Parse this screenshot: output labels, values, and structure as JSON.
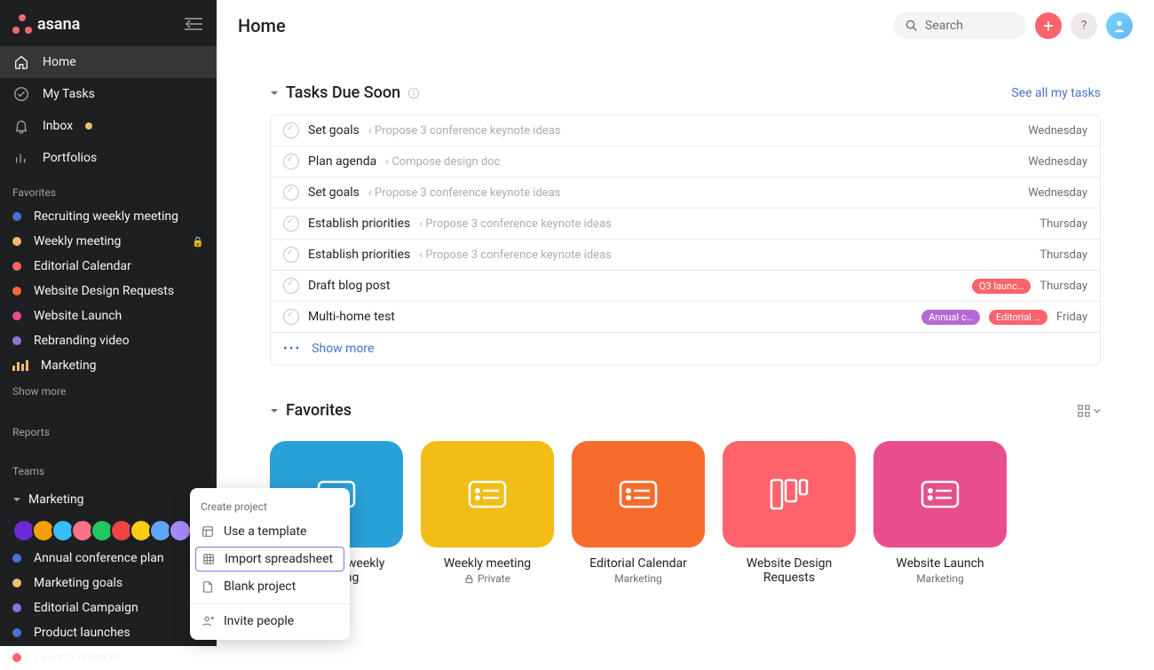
{
  "brand": "asana",
  "header": {
    "title": "Home"
  },
  "search": {
    "placeholder": "Search"
  },
  "nav": {
    "home": "Home",
    "mytasks": "My Tasks",
    "inbox": "Inbox",
    "portfolios": "Portfolios"
  },
  "favorites": {
    "label": "Favorites",
    "show_more": "Show more",
    "items": [
      {
        "label": "Recruiting weekly meeting",
        "color": "#4573d2",
        "locked": false
      },
      {
        "label": "Weekly meeting",
        "color": "#f1bd6c",
        "locked": true
      },
      {
        "label": "Editorial Calendar",
        "color": "#fc636b",
        "locked": false
      },
      {
        "label": "Website Design Requests",
        "color": "#f76b2c",
        "locked": false
      },
      {
        "label": "Website Launch",
        "color": "#e84e8a",
        "locked": false
      },
      {
        "label": "Rebranding video",
        "color": "#9272d6",
        "locked": false
      },
      {
        "label": "Marketing",
        "color": "#f1bd6c",
        "locked": false,
        "bars": true
      }
    ]
  },
  "reports": {
    "label": "Reports"
  },
  "teams": {
    "label": "Teams",
    "team_name": "Marketing",
    "avatar_colors": [
      "#6d28d9",
      "#f59e0b",
      "#38bdf8",
      "#fb7185",
      "#22c55e",
      "#ef4444",
      "#facc15",
      "#60a5fa",
      "#a78bfa"
    ],
    "projects": [
      {
        "label": "Annual conference plan",
        "color": "#4573d2"
      },
      {
        "label": "Marketing goals",
        "color": "#f1bd6c"
      },
      {
        "label": "Editorial Campaign",
        "color": "#9272d6"
      },
      {
        "label": "Product launches",
        "color": "#4573d2"
      },
      {
        "label": "Launch rebrand",
        "color": "#fc636b"
      }
    ]
  },
  "popup": {
    "label": "Create project",
    "template": "Use a template",
    "import": "Import spreadsheet",
    "blank": "Blank project",
    "invite": "Invite people"
  },
  "tasks_due": {
    "title": "Tasks Due Soon",
    "see_all": "See all my tasks",
    "show_more": "Show more",
    "rows": [
      {
        "name": "Set goals",
        "project": "‹ Propose 3 conference keynote ideas",
        "date": "Wednesday",
        "pills": []
      },
      {
        "name": "Plan agenda",
        "project": "‹ Compose design doc",
        "date": "Wednesday",
        "pills": []
      },
      {
        "name": "Set goals",
        "project": "‹ Propose 3 conference keynote ideas",
        "date": "Wednesday",
        "pills": []
      },
      {
        "name": "Establish priorities",
        "project": "‹ Propose 3 conference keynote ideas",
        "date": "Thursday",
        "pills": []
      },
      {
        "name": "Establish priorities",
        "project": "‹ Propose 3 conference keynote ideas",
        "date": "Thursday",
        "pills": []
      },
      {
        "name": "Draft blog post",
        "project": "",
        "date": "Thursday",
        "pills": [
          {
            "text": "Q3 launc…",
            "color": "#fc636b"
          }
        ]
      },
      {
        "name": "Multi-home test",
        "project": "",
        "date": "Friday",
        "pills": [
          {
            "text": "Annual c…",
            "color": "#b36bd4"
          },
          {
            "text": "Editorial …",
            "color": "#fc636b"
          }
        ]
      }
    ]
  },
  "favorites_grid": {
    "title": "Favorites",
    "cards": [
      {
        "title": "Recruiting weekly meeting",
        "sub": "",
        "color": "#29a0d8",
        "icon": "list"
      },
      {
        "title": "Weekly meeting",
        "sub": "Private",
        "color": "#f1bd16",
        "icon": "list",
        "private": true
      },
      {
        "title": "Editorial Calendar",
        "sub": "Marketing",
        "color": "#f76b2c",
        "icon": "list"
      },
      {
        "title": "Website Design Requests",
        "sub": "",
        "color": "#fc636b",
        "icon": "board"
      },
      {
        "title": "Website Launch",
        "sub": "Marketing",
        "color": "#e84e8a",
        "icon": "list"
      }
    ]
  }
}
